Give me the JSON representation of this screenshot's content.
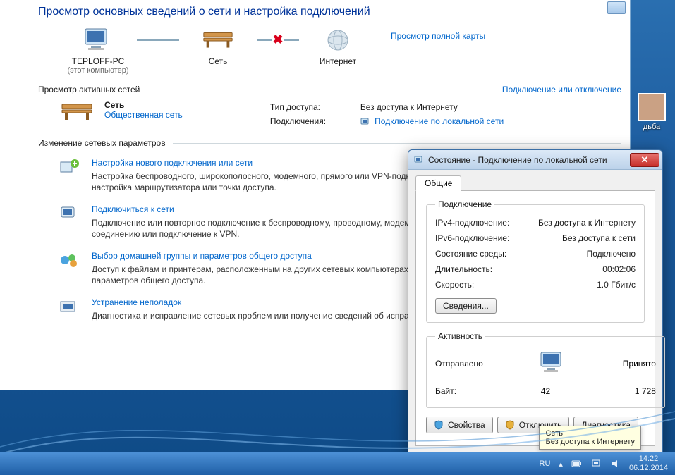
{
  "page_title": "Просмотр основных сведений о сети и настройка подключений",
  "link_full_map": "Просмотр полной карты",
  "topology": {
    "pc": "TEPLOFF-PC",
    "pc_sub": "(этот компьютер)",
    "network": "Сеть",
    "internet": "Интернет"
  },
  "section_active_header": "Просмотр активных сетей",
  "link_connect_disconnect": "Подключение или отключение",
  "active_net": {
    "name": "Сеть",
    "type_label": "Общественная сеть",
    "access_type_k": "Тип доступа:",
    "access_type_v": "Без доступа к Интернету",
    "connections_k": "Подключения:",
    "connections_v": "Подключение по локальной сети"
  },
  "section_change_header": "Изменение сетевых параметров",
  "settings": [
    {
      "title": "Настройка нового подключения или сети",
      "desc": "Настройка беспроводного, широкополосного, модемного, прямого или VPN-подключения или же настройка маршрутизатора или точки доступа."
    },
    {
      "title": "Подключиться к сети",
      "desc": "Подключение или повторное подключение к беспроводному, проводному, модемному сетевому соединению или подключение к VPN."
    },
    {
      "title": "Выбор домашней группы и параметров общего доступа",
      "desc": "Доступ к файлам и принтерам, расположенным на других сетевых компьютерах, или изменение параметров общего доступа."
    },
    {
      "title": "Устранение неполадок",
      "desc": "Диагностика и исправление сетевых проблем или получение сведений об исправлении."
    }
  ],
  "dialog": {
    "title": "Состояние - Подключение по локальной сети",
    "tab_general": "Общие",
    "group_conn": "Подключение",
    "ipv4_k": "IPv4-подключение:",
    "ipv4_v": "Без доступа к Интернету",
    "ipv6_k": "IPv6-подключение:",
    "ipv6_v": "Без доступа к сети",
    "media_k": "Состояние среды:",
    "media_v": "Подключено",
    "dur_k": "Длительность:",
    "dur_v": "00:02:06",
    "speed_k": "Скорость:",
    "speed_v": "1.0 Гбит/с",
    "details_btn": "Сведения...",
    "group_act": "Активность",
    "sent_label": "Отправлено",
    "recv_label": "Принято",
    "bytes_k": "Байт:",
    "bytes_sent": "42",
    "bytes_recv": "1 728",
    "btn_props": "Свойства",
    "btn_disable": "Отключить",
    "btn_diag": "Диагностика"
  },
  "balloon": {
    "line1": "Сеть",
    "line2": "Без доступа к Интернету"
  },
  "desk_icon_label": "дьба",
  "tray_lang": "RU",
  "tray_time": "14:22",
  "tray_date": "06.12.2014"
}
